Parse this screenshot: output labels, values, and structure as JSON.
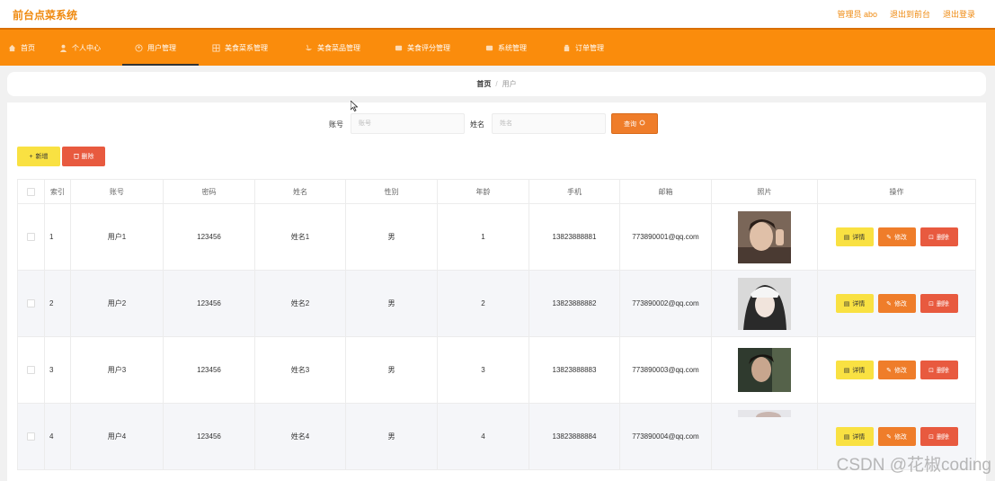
{
  "brand": "前台点菜系统",
  "top_links": [
    "管理员 abo",
    "退出到前台",
    "退出登录"
  ],
  "nav": [
    {
      "label": "首页",
      "icon": "home-icon"
    },
    {
      "label": "个人中心",
      "icon": "user-icon"
    },
    {
      "label": "用户管理",
      "icon": "users-icon",
      "active": true
    },
    {
      "label": "美食菜系管理",
      "icon": "grid-icon"
    },
    {
      "label": "美食菜品管理",
      "icon": "dish-icon"
    },
    {
      "label": "美食评分管理",
      "icon": "star-icon"
    },
    {
      "label": "系统管理",
      "icon": "settings-icon"
    },
    {
      "label": "订单管理",
      "icon": "order-icon"
    }
  ],
  "breadcrumb": {
    "home": "首页",
    "sep": "/",
    "current": "用户"
  },
  "search": {
    "account_label": "账号",
    "account_placeholder": "账号",
    "name_label": "姓名",
    "name_placeholder": "姓名",
    "button": "查询"
  },
  "toolbar": {
    "add": "新增",
    "delete": "删除"
  },
  "table": {
    "headers": [
      "索引",
      "账号",
      "密码",
      "姓名",
      "性别",
      "年龄",
      "手机",
      "邮箱",
      "照片",
      "操作"
    ],
    "rows": [
      {
        "index": "1",
        "account": "用户1",
        "password": "123456",
        "name": "姓名1",
        "gender": "男",
        "age": "1",
        "phone": "13823888881",
        "email": "773890001@qq.com"
      },
      {
        "index": "2",
        "account": "用户2",
        "password": "123456",
        "name": "姓名2",
        "gender": "男",
        "age": "2",
        "phone": "13823888882",
        "email": "773890002@qq.com"
      },
      {
        "index": "3",
        "account": "用户3",
        "password": "123456",
        "name": "姓名3",
        "gender": "男",
        "age": "3",
        "phone": "13823888883",
        "email": "773890003@qq.com"
      },
      {
        "index": "4",
        "account": "用户4",
        "password": "123456",
        "name": "姓名4",
        "gender": "男",
        "age": "4",
        "phone": "13823888884",
        "email": "773890004@qq.com"
      }
    ],
    "actions": {
      "detail": "详情",
      "edit": "修改",
      "delete": "删除"
    }
  },
  "watermark": "CSDN @花椒coding",
  "colors": {
    "accent": "#fa8c0c",
    "brand_text": "#ef8a10",
    "add_yellow": "#f9e142",
    "edit_orange": "#ef7d2a",
    "delete_red": "#e85a3f"
  }
}
